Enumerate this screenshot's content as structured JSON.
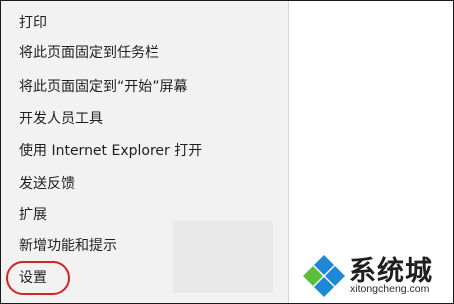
{
  "menu": {
    "items": [
      {
        "label": "打印"
      },
      {
        "label": "将此页面固定到任务栏"
      },
      {
        "label": "将此页面固定到“开始”屏幕"
      },
      {
        "label": "开发人员工具"
      },
      {
        "label": "使用 Internet Explorer 打开"
      },
      {
        "label": "发送反馈"
      },
      {
        "label": "扩展"
      },
      {
        "label": "新增功能和提示"
      },
      {
        "label": "设置"
      }
    ],
    "highlighted_item": "设置",
    "highlight_color": "#d32229"
  },
  "watermark": {
    "title": "系统城",
    "url": "xitongcheng.com",
    "logo_icon": "diamond-logo-icon",
    "colors": {
      "blue": "#1e88d6",
      "green": "#5bbf3a"
    }
  }
}
